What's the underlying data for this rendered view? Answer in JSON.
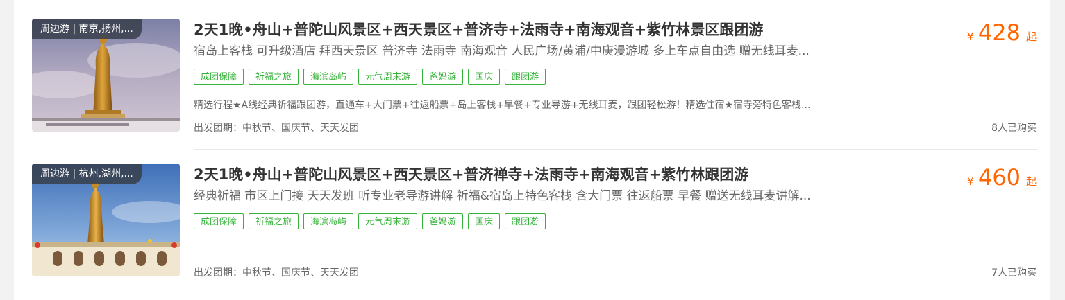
{
  "currency_symbol": "¥",
  "from_label": "起",
  "products": [
    {
      "image_tag": "周边游 | 南京,扬州,...",
      "title": "2天1晚•舟山+普陀山风景区+西天景区+普济寺+法雨寺+南海观音+紫竹林景区跟团游",
      "subtitle": "宿岛上客栈 可升级酒店 拜西天景区 普济寺 法雨寺 南海观音 人民广场/黄浦/中庚漫游城 多上车点自由选 赠无线耳麦...",
      "tags": [
        "成团保障",
        "祈福之旅",
        "海滨岛屿",
        "元气周末游",
        "爸妈游",
        "国庆",
        "跟团游"
      ],
      "description": "精选行程★A线经典祈福跟团游，直通车+大门票+往返船票+岛上客栈+早餐+专业导游+无线耳麦，跟团轻松游！精选住宿★宿寺旁特色客栈...",
      "departure": "出发团期：中秋节、国庆节、天天发团",
      "price": "428",
      "sold": "8人已购买"
    },
    {
      "image_tag": "周边游 | 杭州,湖州,...",
      "title": "2天1晚•舟山+普陀山风景区+西天景区+普济禅寺+法雨寺+南海观音+紫竹林跟团游",
      "subtitle": "经典祈福 市区上门接 天天发班 听专业老导游讲解 祈福&宿岛上特色客栈 含大门票 往返船票 早餐 赠送无线耳麦讲解...",
      "tags": [
        "成团保障",
        "祈福之旅",
        "海滨岛屿",
        "元气周末游",
        "爸妈游",
        "国庆",
        "跟团游"
      ],
      "description": "",
      "departure": "出发团期：中秋节、国庆节、天天发团",
      "price": "460",
      "sold": "7人已购买"
    }
  ]
}
